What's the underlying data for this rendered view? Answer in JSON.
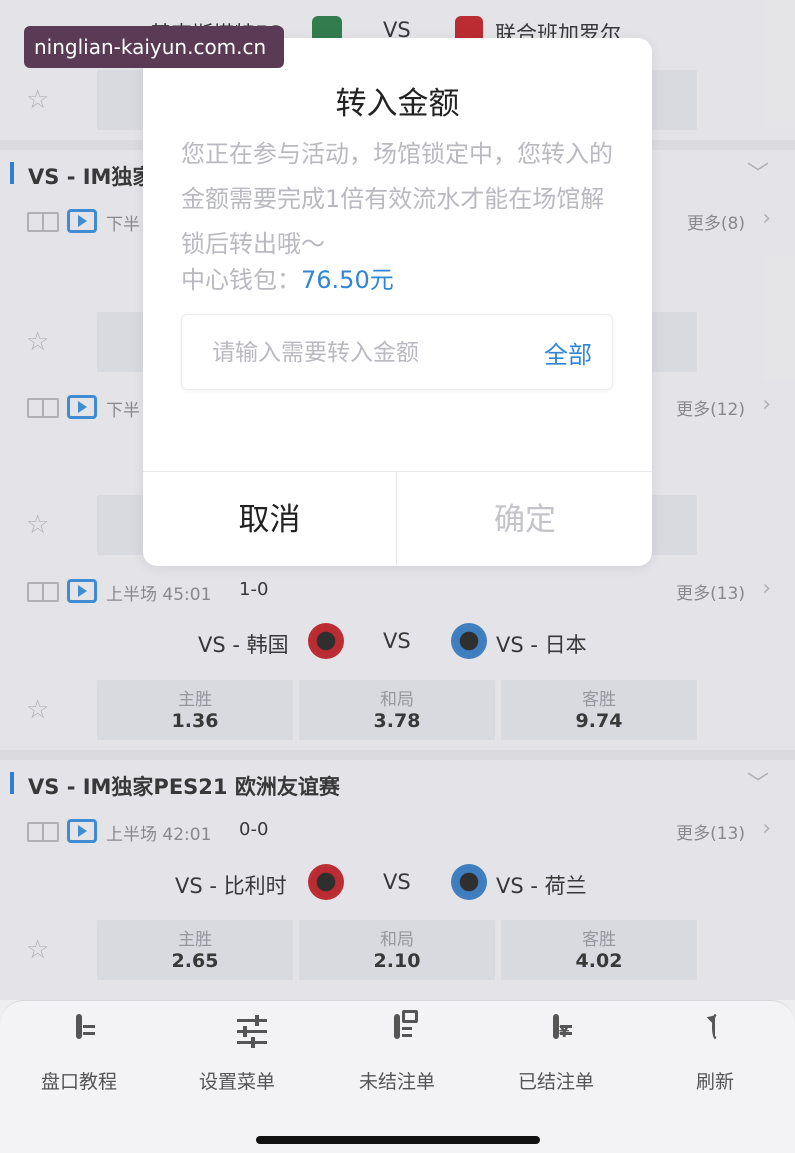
{
  "watermark": "ninglian-kaiyun.com.cn",
  "match0": {
    "home": "基克斯塔特FC",
    "vs": "VS",
    "away": "联合班加罗尔"
  },
  "league1": {
    "name": "VS - IM独家",
    "more1": "更多(8)",
    "phase1": "下半",
    "more2": "更多(12)",
    "phase2": "下半"
  },
  "match3": {
    "phase": "上半场 45:01",
    "score": "1-0",
    "more": "更多(13)",
    "home": "VS - 韩国",
    "vs": "VS",
    "away": "VS - 日本",
    "odds": [
      {
        "label": "主胜",
        "value": "1.36"
      },
      {
        "label": "和局",
        "value": "3.78"
      },
      {
        "label": "客胜",
        "value": "9.74"
      }
    ]
  },
  "league2": {
    "name": "VS - IM独家PES21 欧洲友谊赛"
  },
  "match4": {
    "phase": "上半场 42:01",
    "score": "0-0",
    "more": "更多(13)",
    "home": "VS - 比利时",
    "vs": "VS",
    "away": "VS - 荷兰",
    "odds": [
      {
        "label": "主胜",
        "value": "2.65"
      },
      {
        "label": "和局",
        "value": "2.10"
      },
      {
        "label": "客胜",
        "value": "4.02"
      }
    ]
  },
  "modal": {
    "title": "转入金额",
    "notice": "您正在参与活动，场馆锁定中，您转入的金额需要完成1倍有效流水才能在场馆解锁后转出哦～",
    "wallet_label": "中心钱包：",
    "wallet_amount": "76.50元",
    "input_placeholder": "请输入需要转入金额",
    "all_label": "全部",
    "cancel_label": "取消",
    "confirm_label": "确定"
  },
  "nav": [
    {
      "label": "盘口教程",
      "icon": "document-icon"
    },
    {
      "label": "设置菜单",
      "icon": "sliders-icon"
    },
    {
      "label": "未结注单",
      "icon": "clipboard-icon"
    },
    {
      "label": "已结注单",
      "icon": "receipt-yen-icon"
    },
    {
      "label": "刷新",
      "icon": "refresh-icon"
    }
  ],
  "colors": {
    "accent": "#2f86d6",
    "league_bar": "#2f7fd6",
    "home_badge": "#c0262c",
    "away_badge": "#3b7fc4"
  }
}
